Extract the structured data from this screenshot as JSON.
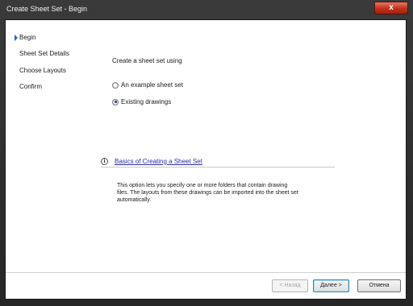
{
  "window": {
    "title": "Create Sheet Set - Begin",
    "close_glyph": "x"
  },
  "sidebar": {
    "items": [
      {
        "label": "Begin",
        "current": true
      },
      {
        "label": "Sheet Set Details",
        "current": false
      },
      {
        "label": "Choose Layouts",
        "current": false
      },
      {
        "label": "Confirm",
        "current": false
      }
    ]
  },
  "main": {
    "heading": "Create a sheet set using",
    "options": [
      {
        "label": "An example sheet set",
        "selected": false
      },
      {
        "label": "Existing drawings",
        "selected": true
      }
    ],
    "info_icon_glyph": "i",
    "help_link": "Basics of Creating a Sheet Set",
    "description": "This option lets you specify one or more folders that contain drawing files.  The layouts from these drawings can be imported into the sheet set automatically."
  },
  "buttons": {
    "back": "< Назад",
    "next": "Далее >",
    "cancel": "Отмена"
  }
}
